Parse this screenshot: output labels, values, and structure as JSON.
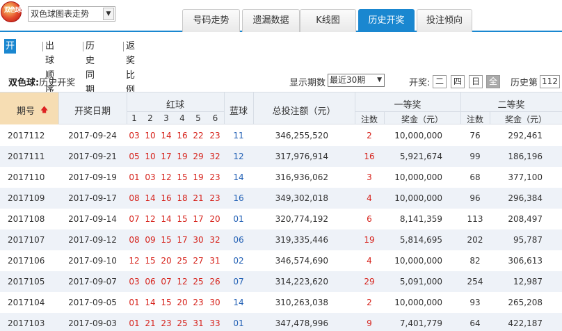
{
  "header": {
    "logo_text": "双色球",
    "lottery_select": "双色球图表走势",
    "tabs": [
      "号码走势",
      "遗漏数据",
      "K线图",
      "历史开奖",
      "投注倾向"
    ],
    "active_tab": "历史开奖"
  },
  "subnav": {
    "items": [
      "开奖信息",
      "出球顺序",
      "历史同期",
      "返奖比例"
    ],
    "active": "开奖信息"
  },
  "toolbar": {
    "title_bold": "双色球:",
    "title_rest": "历史开奖",
    "period_label": "显示期数",
    "period_value": "最近30期",
    "draw_label": "开奖:",
    "days": [
      "二",
      "四",
      "日",
      "全"
    ],
    "active_day": "全",
    "history_label": "历史第",
    "history_value": "112"
  },
  "table": {
    "headers": {
      "issue": "期号",
      "date": "开奖日期",
      "red": "红球",
      "red_positions": [
        "1",
        "2",
        "3",
        "4",
        "5",
        "6"
      ],
      "blue": "蓝球",
      "total": "总投注额（元）",
      "first_prize": "一等奖",
      "second_prize": "二等奖",
      "count": "注数",
      "amount": "奖金（元）"
    },
    "rows": [
      {
        "issue": "2017112",
        "date": "2017-09-24",
        "red": [
          "03",
          "10",
          "14",
          "16",
          "22",
          "23"
        ],
        "blue": "11",
        "total": "346,255,520",
        "p1_count": "2",
        "p1_amount": "10,000,000",
        "p2_count": "76",
        "p2_amount": "292,461"
      },
      {
        "issue": "2017111",
        "date": "2017-09-21",
        "red": [
          "05",
          "10",
          "17",
          "19",
          "29",
          "32"
        ],
        "blue": "12",
        "total": "317,976,914",
        "p1_count": "16",
        "p1_amount": "5,921,674",
        "p2_count": "99",
        "p2_amount": "186,196"
      },
      {
        "issue": "2017110",
        "date": "2017-09-19",
        "red": [
          "01",
          "03",
          "12",
          "15",
          "19",
          "23"
        ],
        "blue": "14",
        "total": "316,936,062",
        "p1_count": "3",
        "p1_amount": "10,000,000",
        "p2_count": "68",
        "p2_amount": "377,100"
      },
      {
        "issue": "2017109",
        "date": "2017-09-17",
        "red": [
          "08",
          "14",
          "16",
          "18",
          "21",
          "23"
        ],
        "blue": "16",
        "total": "349,302,018",
        "p1_count": "4",
        "p1_amount": "10,000,000",
        "p2_count": "96",
        "p2_amount": "296,384"
      },
      {
        "issue": "2017108",
        "date": "2017-09-14",
        "red": [
          "07",
          "12",
          "14",
          "15",
          "17",
          "20"
        ],
        "blue": "01",
        "total": "320,774,192",
        "p1_count": "6",
        "p1_amount": "8,141,359",
        "p2_count": "113",
        "p2_amount": "208,497"
      },
      {
        "issue": "2017107",
        "date": "2017-09-12",
        "red": [
          "08",
          "09",
          "15",
          "17",
          "30",
          "32"
        ],
        "blue": "06",
        "total": "319,335,446",
        "p1_count": "19",
        "p1_amount": "5,814,695",
        "p2_count": "202",
        "p2_amount": "95,787"
      },
      {
        "issue": "2017106",
        "date": "2017-09-10",
        "red": [
          "12",
          "15",
          "20",
          "25",
          "27",
          "31"
        ],
        "blue": "02",
        "total": "346,574,690",
        "p1_count": "4",
        "p1_amount": "10,000,000",
        "p2_count": "82",
        "p2_amount": "306,613"
      },
      {
        "issue": "2017105",
        "date": "2017-09-07",
        "red": [
          "03",
          "06",
          "07",
          "12",
          "25",
          "26"
        ],
        "blue": "07",
        "total": "314,223,620",
        "p1_count": "29",
        "p1_amount": "5,091,000",
        "p2_count": "254",
        "p2_amount": "12,987"
      },
      {
        "issue": "2017104",
        "date": "2017-09-05",
        "red": [
          "01",
          "14",
          "15",
          "20",
          "23",
          "30"
        ],
        "blue": "14",
        "total": "310,263,038",
        "p1_count": "2",
        "p1_amount": "10,000,000",
        "p2_count": "93",
        "p2_amount": "265,208"
      },
      {
        "issue": "2017103",
        "date": "2017-09-03",
        "red": [
          "01",
          "21",
          "23",
          "25",
          "31",
          "33"
        ],
        "blue": "01",
        "total": "347,478,996",
        "p1_count": "9",
        "p1_amount": "7,401,779",
        "p2_count": "64",
        "p2_amount": "422,187"
      }
    ]
  },
  "colors": {
    "accent": "#1a87d0",
    "red_ball": "#d6221b",
    "blue_ball": "#2361b5",
    "sort_header": "#f6ddb3",
    "stripe": "#eef2f8"
  }
}
